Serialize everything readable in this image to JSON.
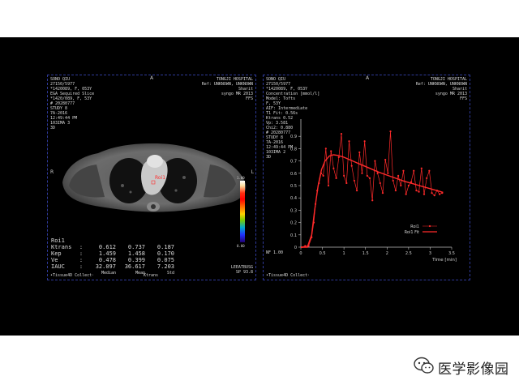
{
  "left_viewport": {
    "top_left": [
      "SONO QIU",
      "27150/5977",
      "*1420089, F, 053Y",
      "EGA Sequired Slice",
      "*1420/089, F, 53Y",
      "",
      "# 20280777",
      "STUDY 8",
      "7A-2016",
      "12:49:44 PM",
      "103IMA 3",
      "3D"
    ],
    "top_right": [
      "TONGJI HOSPITAL",
      "Ref: UNKNOWN, UNKNOWN",
      "Sharit",
      "syngo MR 2013",
      "FFS"
    ],
    "orient_top": "A",
    "orient_right": "L",
    "orient_left": "R",
    "roi_label": "Roi1",
    "colorbar_max": "1.00",
    "colorbar_min": "0.00",
    "bottom_right": [
      "LEEATBUSG",
      "SP 93.8"
    ],
    "footer_left": "•Tissue4D Collect·",
    "footer_right": "Ktrans",
    "stats": {
      "title": "Roi1",
      "rows": [
        {
          "name": "Ktrans",
          "sep": ":",
          "v1": "0.612",
          "v2": "0.737",
          "v3": "0.187"
        },
        {
          "name": "Kep",
          "sep": ":",
          "v1": "1.459",
          "v2": "1.458",
          "v3": "0.170"
        },
        {
          "name": "Ve",
          "sep": ":",
          "v1": "0.478",
          "v2": "0.399",
          "v3": "0.075"
        },
        {
          "name": "IAUC",
          "sep": ":",
          "v1": "32.097",
          "v2": "36.617",
          "v3": "7.203"
        }
      ],
      "footer": [
        "Median",
        "Mean",
        "Std"
      ]
    }
  },
  "right_viewport": {
    "top_left": [
      "SONO QIU",
      "27150/5977",
      "*1420089, F, 053Y",
      "Concentration [mmol/l]",
      "Model: Tofts",
      "F, 53Y",
      "AIF: Intermediate",
      "T1 Fit: 0.56s",
      "Ktrans 0.52",
      "Vp: 3.581",
      "Chi2: 0.880"
    ],
    "top_left_extra": [
      "# 20280777",
      "STUDY 8",
      "7A-2016",
      "12:49:44 PM",
      "103IMA 2",
      "3D"
    ],
    "top_right": [
      "TONGJI HOSPITAL",
      "Ref: UNKNOWN, UNKNOWN",
      "Sharit",
      "syngo MR 2013",
      "FFS"
    ],
    "orient_top": "A",
    "bottom_left": "NF 1.00",
    "footer_left": "•Tissue4D Collect·",
    "time_label": "Time [min]",
    "legend": [
      {
        "label": "Roi1",
        "color": "#ff2a2a",
        "style": "dots"
      },
      {
        "label": "Roi1 Fit",
        "color": "#ff2a2a",
        "style": "line"
      }
    ]
  },
  "chart_data": {
    "type": "line",
    "xlabel": "Time [min]",
    "ylabel": "",
    "xlim": [
      0,
      3.5
    ],
    "ylim": [
      0,
      1.0
    ],
    "xticks": [
      "0",
      "0.5",
      "1",
      "1.5",
      "2",
      "2.5",
      "3",
      "3.5"
    ],
    "yticks": [
      "0",
      "0.1",
      "0.2",
      "0.3",
      "0.4",
      "0.5",
      "0.6",
      "0.7",
      "0.8",
      "0.9"
    ],
    "series": [
      {
        "name": "Roi1",
        "x": [
          0.02,
          0.1,
          0.18,
          0.25,
          0.3,
          0.34,
          0.38,
          0.42,
          0.47,
          0.52,
          0.58,
          0.64,
          0.7,
          0.76,
          0.82,
          0.88,
          0.94,
          1.0,
          1.06,
          1.12,
          1.18,
          1.24,
          1.3,
          1.36,
          1.42,
          1.48,
          1.54,
          1.6,
          1.66,
          1.72,
          1.78,
          1.84,
          1.9,
          1.96,
          2.02,
          2.08,
          2.14,
          2.2,
          2.26,
          2.32,
          2.38,
          2.44,
          2.5,
          2.56,
          2.62,
          2.68,
          2.74,
          2.8,
          2.86,
          2.92,
          2.98,
          3.04,
          3.1,
          3.16,
          3.22,
          3.28
        ],
        "values": [
          0.0,
          0.01,
          0.01,
          0.08,
          0.2,
          0.35,
          0.46,
          0.52,
          0.6,
          0.58,
          0.8,
          0.5,
          0.78,
          0.64,
          0.56,
          0.73,
          0.92,
          0.58,
          0.52,
          0.86,
          0.66,
          0.54,
          0.46,
          0.77,
          0.6,
          0.86,
          0.58,
          0.56,
          0.38,
          0.7,
          0.6,
          0.52,
          0.44,
          0.71,
          0.6,
          0.94,
          0.54,
          0.46,
          0.58,
          0.5,
          0.62,
          0.43,
          0.5,
          0.53,
          0.62,
          0.46,
          0.45,
          0.64,
          0.43,
          0.56,
          0.62,
          0.44,
          0.42,
          0.46,
          0.43,
          0.44
        ]
      },
      {
        "name": "Roi1 Fit",
        "x": [
          0.0,
          0.15,
          0.25,
          0.32,
          0.4,
          0.48,
          0.56,
          0.66,
          0.76,
          0.86,
          1.0,
          1.2,
          1.4,
          1.6,
          1.8,
          2.0,
          2.2,
          2.4,
          2.6,
          2.8,
          3.0,
          3.2,
          3.3
        ],
        "values": [
          0.0,
          0.0,
          0.1,
          0.3,
          0.5,
          0.63,
          0.7,
          0.74,
          0.75,
          0.745,
          0.73,
          0.7,
          0.67,
          0.64,
          0.61,
          0.585,
          0.56,
          0.535,
          0.515,
          0.495,
          0.475,
          0.455,
          0.445
        ]
      }
    ]
  },
  "brand": {
    "text": "医学影像园",
    "icon": "wechat-icon",
    "accent": "#222222"
  }
}
